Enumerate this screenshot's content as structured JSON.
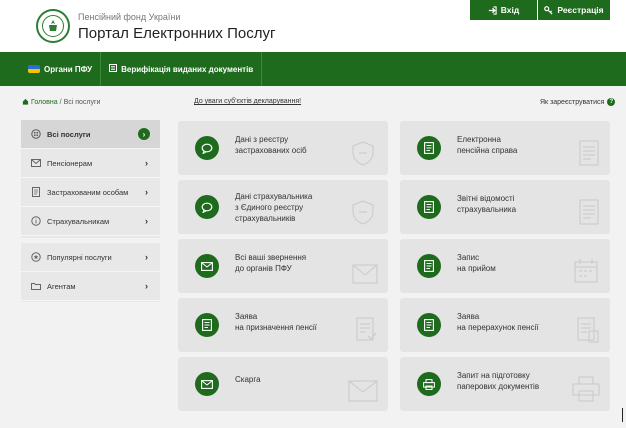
{
  "header": {
    "org_name": "Пенсійний фонд України",
    "portal_title": "Портал Електронних Послуг",
    "login_label": "Вхід",
    "register_label": "Реєстрація"
  },
  "navbar": {
    "items": [
      {
        "label": "Органи ПФУ",
        "icon": "flag-icon"
      },
      {
        "label": "Верифікація виданих документів",
        "icon": "list-icon"
      }
    ]
  },
  "breadcrumb": {
    "home": "Головна",
    "separator": "/",
    "current": "Всі послуги"
  },
  "notice_link": "До уваги суб'єктів декларування!",
  "how_register": "Як зареєструватися",
  "sidebar": {
    "group1": [
      {
        "label": "Всі послуги",
        "icon": "grid-icon",
        "active": true
      },
      {
        "label": "Пенсіонерам",
        "icon": "mail-icon"
      },
      {
        "label": "Застрахованим особам",
        "icon": "document-icon"
      },
      {
        "label": "Страхувальникам",
        "icon": "info-icon"
      }
    ],
    "group2": [
      {
        "label": "Популярні послуги",
        "icon": "star-icon"
      },
      {
        "label": "Агентам",
        "icon": "folder-icon"
      }
    ]
  },
  "cards": {
    "left": [
      {
        "label": "Дані з реєстру\nзастрахованих осіб",
        "icon": "chat-icon"
      },
      {
        "label": "Дані страхувальника\nз Єдиного реєстру\nстрахувальників",
        "icon": "chat-icon"
      },
      {
        "label": "Всі ваші звернення\nдо органів ПФУ",
        "icon": "mail-icon"
      },
      {
        "label": "Заява\nна призначення пенсії",
        "icon": "document-icon"
      },
      {
        "label": "Скарга",
        "icon": "mail-icon"
      }
    ],
    "right": [
      {
        "label": "Електронна\nпенсійна справа",
        "icon": "document-icon"
      },
      {
        "label": "Звітні відомості\nстрахувальника",
        "icon": "document-icon"
      },
      {
        "label": "Запис\nна прийом",
        "icon": "calendar-icon"
      },
      {
        "label": "Заява\nна перерахунок пенсії",
        "icon": "document-icon"
      },
      {
        "label": "Запит на підготовку\nпаперових документів",
        "icon": "printer-icon"
      }
    ]
  },
  "colors": {
    "brand_green": "#1e6b1e",
    "card_bg": "#e4e4e4",
    "page_bg": "#f2f2f2"
  }
}
